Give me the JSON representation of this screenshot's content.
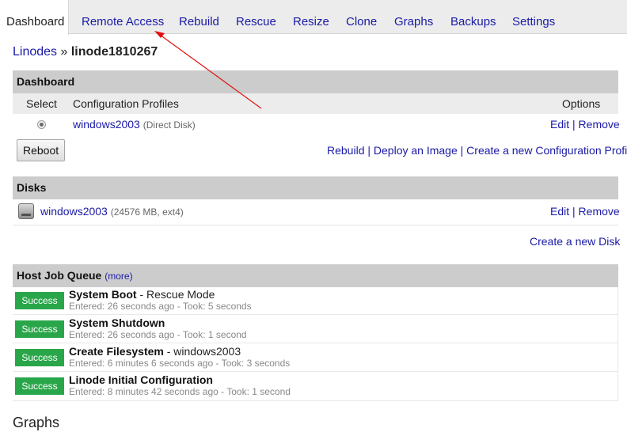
{
  "tabs": {
    "dashboard": "Dashboard",
    "remote_access": "Remote Access",
    "rebuild": "Rebuild",
    "rescue": "Rescue",
    "resize": "Resize",
    "clone": "Clone",
    "graphs": "Graphs",
    "backups": "Backups",
    "settings": "Settings"
  },
  "breadcrumb": {
    "parent": "Linodes",
    "separator": "»",
    "current": "linode1810267"
  },
  "dashboard": {
    "title": "Dashboard",
    "col_select": "Select",
    "col_profiles": "Configuration Profiles",
    "col_options": "Options",
    "profile_name": "windows2003",
    "profile_detail": "(Direct Disk)",
    "edit": "Edit",
    "pipe": "|",
    "remove": "Remove",
    "reboot": "Reboot",
    "action_rebuild": "Rebuild",
    "action_deploy": "Deploy an Image",
    "action_create_profile": "Create a new Configuration Profile"
  },
  "disks": {
    "title": "Disks",
    "disk_name": "windows2003",
    "disk_detail": "(24576 MB, ext4)",
    "icon": "hard-disk-icon",
    "edit": "Edit",
    "pipe": "|",
    "remove": "Remove",
    "create": "Create a new Disk"
  },
  "jobs": {
    "title": "Host Job Queue",
    "more": "(more)",
    "status_color": "#2aa64a",
    "items": [
      {
        "status": "Success",
        "title": "System Boot",
        "subtitle": " - Rescue Mode",
        "meta": "Entered: 26 seconds ago - Took: 5 seconds"
      },
      {
        "status": "Success",
        "title": "System Shutdown",
        "subtitle": "",
        "meta": "Entered: 26 seconds ago - Took: 1 second"
      },
      {
        "status": "Success",
        "title": "Create Filesystem",
        "subtitle": " - windows2003",
        "meta": "Entered: 6 minutes 6 seconds ago - Took: 3 seconds"
      },
      {
        "status": "Success",
        "title": "Linode Initial Configuration",
        "subtitle": "",
        "meta": "Entered: 8 minutes 42 seconds ago - Took: 1 second"
      }
    ]
  },
  "graphs": {
    "title": "Graphs"
  },
  "annotation": {
    "arrow_color": "#e01010"
  }
}
